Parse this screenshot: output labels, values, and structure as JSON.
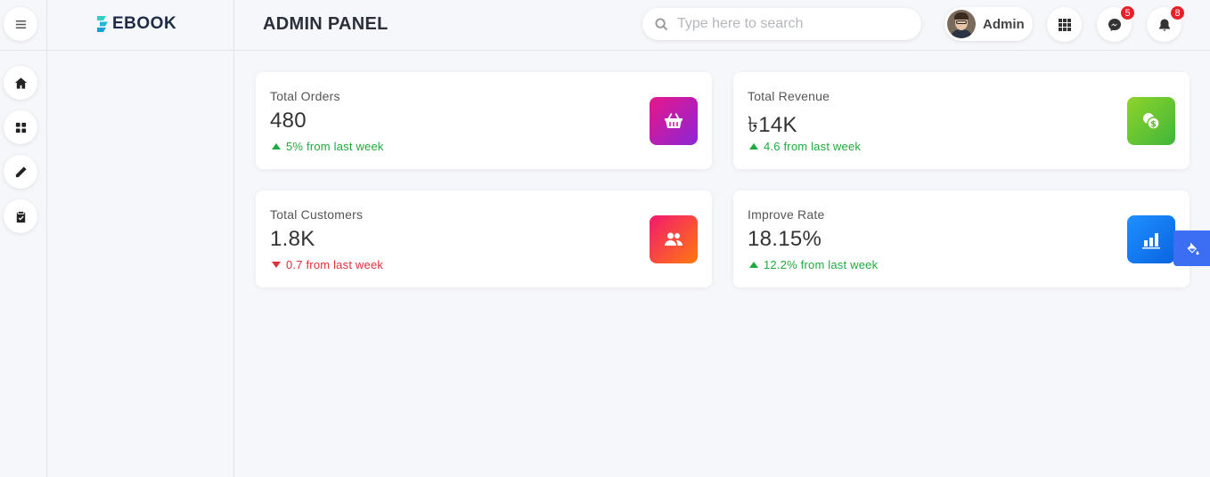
{
  "brand": {
    "name": "EBOOK"
  },
  "header": {
    "title": "ADMIN PANEL",
    "search_placeholder": "Type here to search",
    "user_name": "Admin",
    "messages_badge": "5",
    "notifications_badge": "8"
  },
  "rail": {
    "items": [
      {
        "icon": "home-icon"
      },
      {
        "icon": "grid-icon"
      },
      {
        "icon": "pencil-icon"
      },
      {
        "icon": "clipboard-icon"
      }
    ]
  },
  "cards": [
    {
      "label": "Total Orders",
      "value": "480",
      "trend": "5% from last week",
      "direction": "up",
      "icon": "basket-icon",
      "gradient": [
        "#e8168a",
        "#8b26d6"
      ]
    },
    {
      "label": "Total Revenue",
      "value": "৳14K",
      "trend": "4.6 from last week",
      "direction": "up",
      "icon": "coins-icon",
      "gradient": [
        "#8fd42a",
        "#3fb63a"
      ]
    },
    {
      "label": "Total Customers",
      "value": "1.8K",
      "trend": "0.7 from last week",
      "direction": "down",
      "icon": "users-icon",
      "gradient": [
        "#f2186e",
        "#ff7a10"
      ]
    },
    {
      "label": "Improve Rate",
      "value": "18.15%",
      "trend": "12.2% from last week",
      "direction": "up",
      "icon": "bar-chart-icon",
      "gradient": [
        "#1e90ff",
        "#0a63e0"
      ]
    }
  ],
  "colors": {
    "accent": "#3b6ef2",
    "up": "#1faa3d",
    "down": "#e0303a",
    "badge": "#e8202a"
  }
}
